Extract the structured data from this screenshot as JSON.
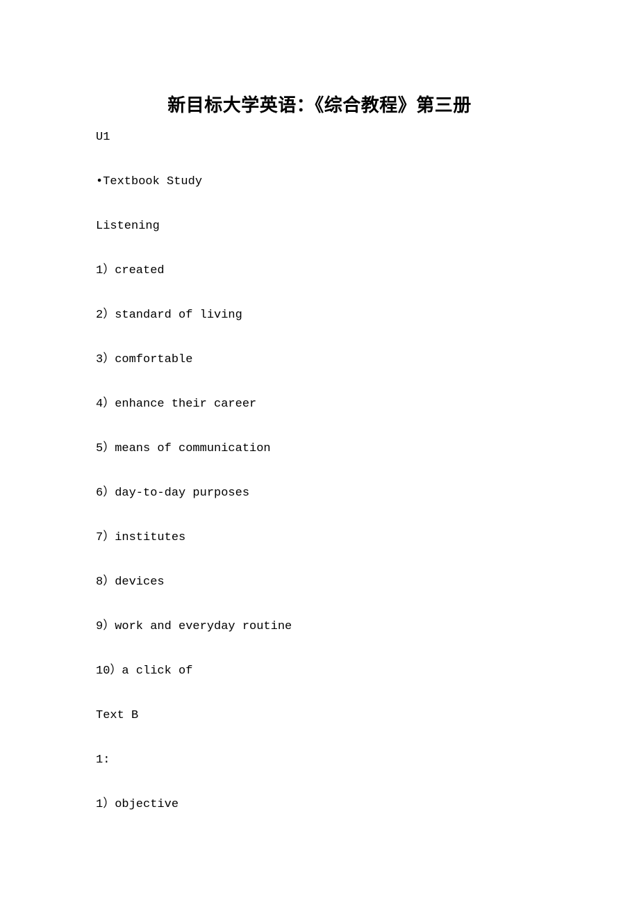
{
  "document": {
    "title": "新目标大学英语：《综合教程》第三册",
    "background_color": "#ffffff",
    "text_color": "#000000",
    "lines": [
      {
        "id": "unit-label",
        "text": "U1"
      },
      {
        "id": "section-textbook",
        "text": "•Textbook Study"
      },
      {
        "id": "section-listening",
        "text": "Listening"
      },
      {
        "id": "listening-1",
        "text": "1）created"
      },
      {
        "id": "listening-2",
        "text": "2）standard of living"
      },
      {
        "id": "listening-3",
        "text": "3）comfortable"
      },
      {
        "id": "listening-4",
        "text": "4）enhance their career"
      },
      {
        "id": "listening-5",
        "text": "5）means of communication"
      },
      {
        "id": "listening-6",
        "text": "6）day-to-day purposes"
      },
      {
        "id": "listening-7",
        "text": "7）institutes"
      },
      {
        "id": "listening-8",
        "text": "8）devices"
      },
      {
        "id": "listening-9",
        "text": "9）work and everyday routine"
      },
      {
        "id": "listening-10",
        "text": "10）a click of"
      },
      {
        "id": "section-text-b",
        "text": "Text B"
      },
      {
        "id": "exercise-1-label",
        "text": "1:"
      },
      {
        "id": "text-b-1",
        "text": "1）objective"
      }
    ]
  }
}
